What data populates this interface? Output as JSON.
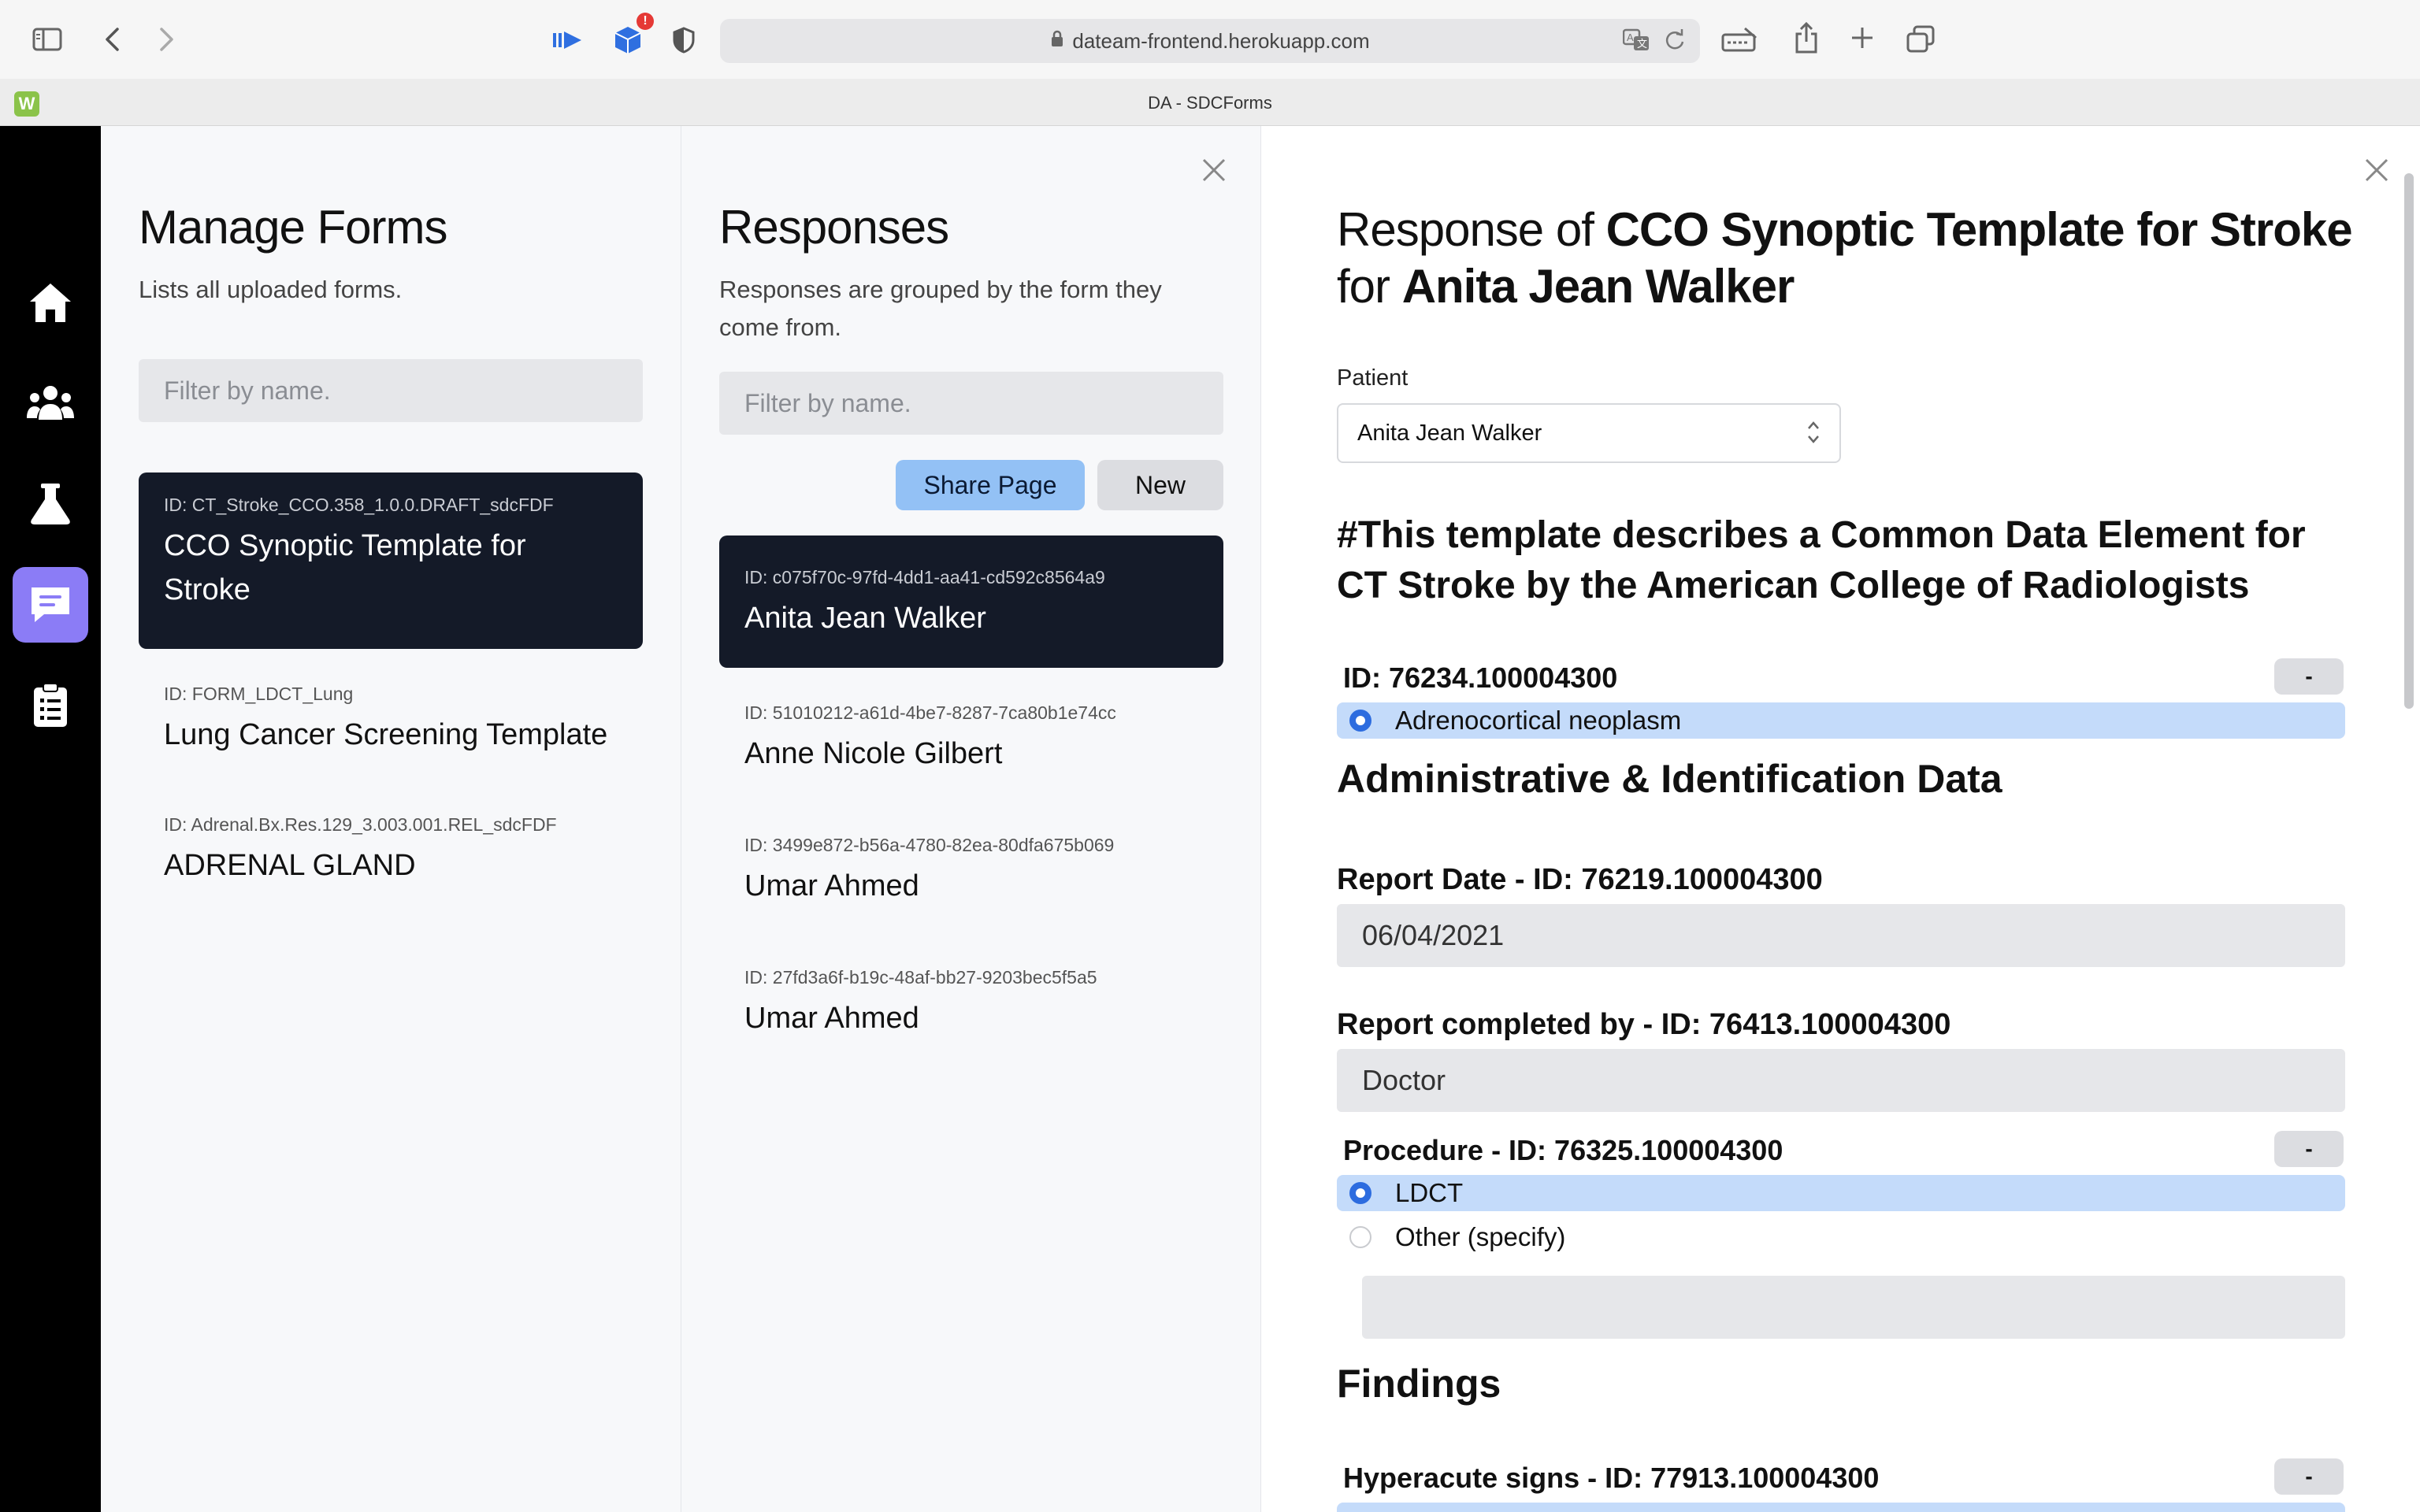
{
  "browser": {
    "url": "dateam-frontend.herokuapp.com",
    "tab_title": "DA - SDCForms",
    "favicon_letter": "W",
    "extension_badge": "!"
  },
  "nav": {
    "items": [
      {
        "name": "home-icon"
      },
      {
        "name": "users-icon"
      },
      {
        "name": "flask-icon"
      },
      {
        "name": "forms-chat-icon",
        "active": true
      },
      {
        "name": "clipboard-icon"
      }
    ]
  },
  "forms": {
    "title": "Manage Forms",
    "subtitle": "Lists all uploaded forms.",
    "filter_placeholder": "Filter by name.",
    "items": [
      {
        "id": "ID: CT_Stroke_CCO.358_1.0.0.DRAFT_sdcFDF",
        "name": "CCO Synoptic Template for Stroke"
      },
      {
        "id": "ID: FORM_LDCT_Lung",
        "name": "Lung Cancer Screening Template"
      },
      {
        "id": "ID: Adrenal.Bx.Res.129_3.003.001.REL_sdcFDF",
        "name": "ADRENAL GLAND"
      }
    ]
  },
  "responses": {
    "title": "Responses",
    "subtitle": "Responses are grouped by the form they come from.",
    "filter_placeholder": "Filter by name.",
    "share_label": "Share Page",
    "new_label": "New",
    "items": [
      {
        "id": "ID: c075f70c-97fd-4dd1-aa41-cd592c8564a9",
        "name": "Anita Jean Walker"
      },
      {
        "id": "ID: 51010212-a61d-4be7-8287-7ca80b1e74cc",
        "name": "Anne Nicole Gilbert"
      },
      {
        "id": "ID: 3499e872-b56a-4780-82ea-80dfa675b069",
        "name": "Umar Ahmed"
      },
      {
        "id": "ID: 27fd3a6f-b19c-48af-bb27-9203bec5f5a5",
        "name": "Umar Ahmed"
      }
    ]
  },
  "detail": {
    "title_prefix": "Response of ",
    "form_name": "CCO Synoptic Template for Stroke",
    "title_for": "for ",
    "patient_name": "Anita Jean Walker",
    "patient_label": "Patient",
    "patient_value": "Anita Jean Walker",
    "template_heading": "#This template describes a Common Data Element for CT Stroke by the American College of Radiologists",
    "q1": {
      "label": "ID: 76234.100004300",
      "toggle": "-",
      "option": "Adrenocortical neoplasm"
    },
    "admin_heading": "Administrative & Identification Data",
    "report_date": {
      "label": "Report Date - ID: 76219.100004300",
      "value": "06/04/2021"
    },
    "report_by": {
      "label": "Report completed by - ID: 76413.100004300",
      "value": "Doctor"
    },
    "procedure": {
      "label": "Procedure - ID: 76325.100004300",
      "toggle": "-",
      "options": [
        "LDCT",
        "Other (specify)"
      ],
      "other_value": ""
    },
    "findings_heading": "Findings",
    "hyperacute": {
      "label": "Hyperacute signs - ID: 77913.100004300",
      "toggle": "-"
    }
  },
  "colors": {
    "nav_active": "#8b7cf6",
    "card_selected": "#141a28",
    "share_button": "#93c1f5",
    "option_selected": "#c4dbfa",
    "radio_on": "#2d6cdf"
  }
}
